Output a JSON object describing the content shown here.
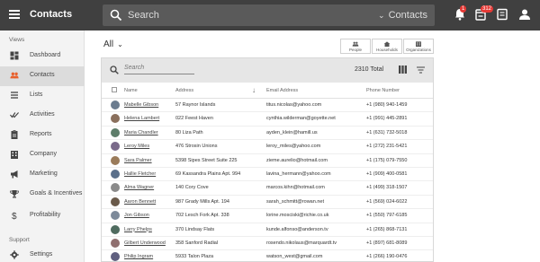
{
  "header": {
    "app_title": "Contacts",
    "search_placeholder": "Search",
    "search_scope": "Contacts",
    "notifications_badge": "1",
    "tasks_badge": "312"
  },
  "sidebar": {
    "section_views": "Views",
    "items": [
      {
        "label": "Dashboard",
        "icon": "dashboard-icon"
      },
      {
        "label": "Contacts",
        "icon": "people-icon",
        "active": true
      },
      {
        "label": "Lists",
        "icon": "list-icon"
      },
      {
        "label": "Activities",
        "icon": "check-icon"
      },
      {
        "label": "Reports",
        "icon": "clipboard-icon"
      },
      {
        "label": "Company",
        "icon": "building-icon"
      },
      {
        "label": "Marketing",
        "icon": "megaphone-icon"
      },
      {
        "label": "Goals & Incentives",
        "icon": "trophy-icon"
      },
      {
        "label": "Profitability",
        "icon": "dollar-icon"
      }
    ],
    "section_support": "Support",
    "settings_label": "Settings"
  },
  "main": {
    "filter_label": "All",
    "views": [
      {
        "label": "People",
        "icon": "people-icon"
      },
      {
        "label": "Households",
        "icon": "home-icon"
      },
      {
        "label": "Organizations",
        "icon": "organization-icon"
      }
    ],
    "search_placeholder": "Search",
    "total_label": "2310 Total",
    "columns": {
      "name": "Name",
      "address": "Address",
      "email": "Email Address",
      "phone": "Phone Number"
    },
    "rows": [
      {
        "name": "Mabelle Gibson",
        "address": "57 Raynor Islands",
        "email": "titus.nicolas@yahoo.com",
        "phone": "+1 (980) 940-1459"
      },
      {
        "name": "Helena Lambert",
        "address": "022 Feest Haven",
        "email": "cynthia.wilderman@goyette.net",
        "phone": "+1 (991) 445-2891"
      },
      {
        "name": "Maria Chandler",
        "address": "80 Liza Path",
        "email": "ayden_klein@hamill.us",
        "phone": "+1 (631) 732-5018"
      },
      {
        "name": "Leroy Miles",
        "address": "476 Strosin Unions",
        "email": "leroy_miles@yahoo.com",
        "phone": "+1 (272) 231-5421"
      },
      {
        "name": "Sara Palmer",
        "address": "5398 Sipes Street Suite 225",
        "email": "zieme.aurelio@hotmail.com",
        "phone": "+1 (175) 079-7550"
      },
      {
        "name": "Hallie Fletcher",
        "address": "69 Kassandra Plains Apt. 994",
        "email": "lavina_hermann@yahoo.com",
        "phone": "+1 (909) 400-0581"
      },
      {
        "name": "Alma Wagner",
        "address": "140 Cory Cove",
        "email": "marcos.kihn@hotmail.com",
        "phone": "+1 (499) 318-1507"
      },
      {
        "name": "Aaron Bennett",
        "address": "987 Grady Mills Apt. 194",
        "email": "sarah_schmitt@rowan.net",
        "phone": "+1 (569) 024-6022"
      },
      {
        "name": "Jon Gibson",
        "address": "702 Lesch Fork Apt. 338",
        "email": "lorine.mosciskі@richie.co.uk",
        "phone": "+1 (550) 797-6185"
      },
      {
        "name": "Larry Phelps",
        "address": "370 Lindsay Flats",
        "email": "kunde.alfonso@anderson.tv",
        "phone": "+1 (265) 868-7131"
      },
      {
        "name": "Gilbert Underwood",
        "address": "358 Sanford Radial",
        "email": "rosendo.nikolaus@marquardt.tv",
        "phone": "+1 (897) 681-8089"
      },
      {
        "name": "Philip Ingram",
        "address": "5933 Talon Plaza",
        "email": "watson_west@gmail.com",
        "phone": "+1 (266) 190-0476"
      }
    ]
  },
  "colors": {
    "topbar": "#404040",
    "sidebar": "#f3f3f3",
    "active_nav": "#dcdcdc",
    "accent_contacts": "#e8602c",
    "badge": "#e53935"
  }
}
